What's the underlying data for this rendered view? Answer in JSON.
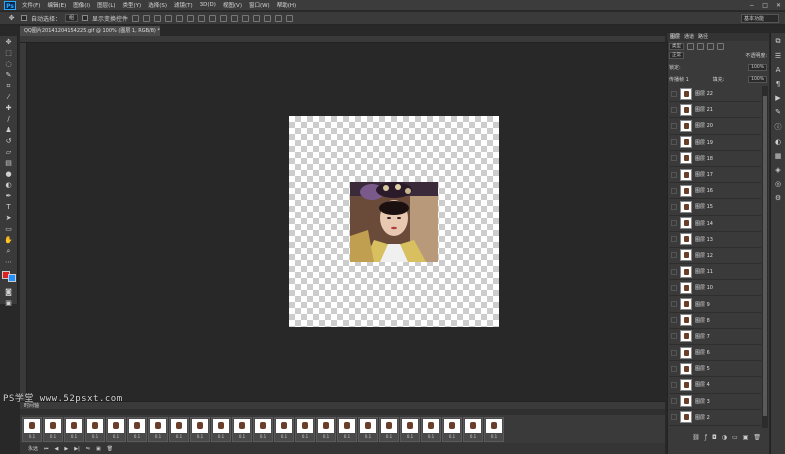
{
  "app": {
    "logo": "Ps"
  },
  "menu": [
    "文件(F)",
    "编辑(E)",
    "图像(I)",
    "图层(L)",
    "类型(Y)",
    "选择(S)",
    "滤镜(T)",
    "3D(D)",
    "视图(V)",
    "窗口(W)",
    "帮助(H)"
  ],
  "options": {
    "auto_select_label": "自动选择：",
    "auto_select_value": "组",
    "transform_label": "显示变换控件",
    "workspace": "基本功能"
  },
  "document_tab": {
    "title": "QQ图片20141204154225.gif @ 100% (图层 1, RGB/8) *"
  },
  "timeline": {
    "header": "时间轴",
    "duration_label": "0秒",
    "loop_label": "永远"
  },
  "frames": [
    {
      "n": "1",
      "t": "0.1"
    },
    {
      "n": "2",
      "t": "0.1"
    },
    {
      "n": "3",
      "t": "0.1"
    },
    {
      "n": "4",
      "t": "0.1"
    },
    {
      "n": "5",
      "t": "0.1"
    },
    {
      "n": "6",
      "t": "0.1"
    },
    {
      "n": "7",
      "t": "0.1"
    },
    {
      "n": "8",
      "t": "0.1"
    },
    {
      "n": "9",
      "t": "0.1"
    },
    {
      "n": "10",
      "t": "0.1"
    },
    {
      "n": "11",
      "t": "0.1"
    },
    {
      "n": "12",
      "t": "0.1"
    },
    {
      "n": "13",
      "t": "0.1"
    },
    {
      "n": "14",
      "t": "0.1"
    },
    {
      "n": "15",
      "t": "0.1"
    },
    {
      "n": "16",
      "t": "0.1"
    },
    {
      "n": "17",
      "t": "0.1"
    },
    {
      "n": "18",
      "t": "0.1"
    },
    {
      "n": "19",
      "t": "0.1"
    },
    {
      "n": "20",
      "t": "0.1"
    },
    {
      "n": "21",
      "t": "0.1"
    },
    {
      "n": "22",
      "t": "0.1"
    },
    {
      "n": "23",
      "t": "0.1"
    }
  ],
  "watermark": "PS学堂 www.52psxt.com",
  "layers_panel": {
    "tabs": [
      "图层",
      "通道",
      "路径"
    ],
    "filter": "类型",
    "blend": "正常",
    "opacity_label": "不透明度:",
    "opacity": "100%",
    "lock_label": "锁定:",
    "fill_label": "填充:",
    "fill": "100%",
    "unify_label": "传播帧 1",
    "layers": [
      "图层 22",
      "图层 21",
      "图层 20",
      "图层 19",
      "图层 18",
      "图层 17",
      "图层 16",
      "图层 15",
      "图层 14",
      "图层 13",
      "图层 12",
      "图层 11",
      "图层 10",
      "图层 9",
      "图层 8",
      "图层 7",
      "图层 6",
      "图层 5",
      "图层 4",
      "图层 3",
      "图层 2"
    ]
  },
  "colors": {
    "foreground": "#e02020",
    "background": "#1e90ff",
    "ps_blue": "#31a8ff"
  }
}
